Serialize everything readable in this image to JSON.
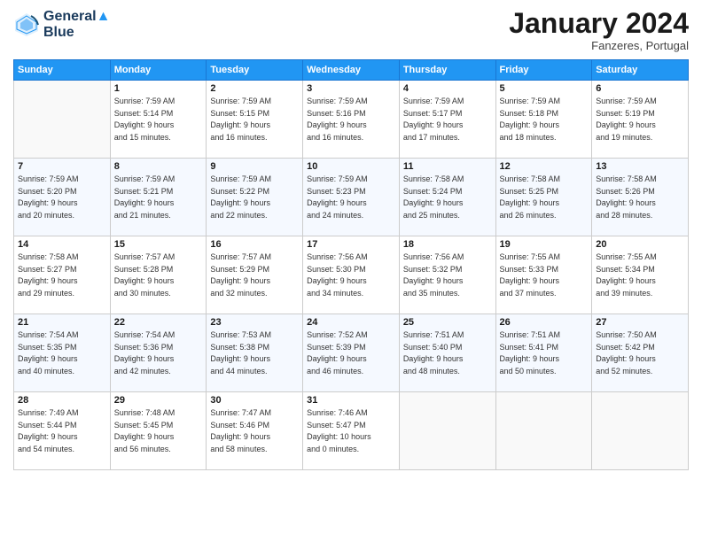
{
  "header": {
    "logo_line1": "General",
    "logo_line2": "Blue",
    "month": "January 2024",
    "location": "Fanzeres, Portugal"
  },
  "weekdays": [
    "Sunday",
    "Monday",
    "Tuesday",
    "Wednesday",
    "Thursday",
    "Friday",
    "Saturday"
  ],
  "weeks": [
    [
      {
        "day": "",
        "info": ""
      },
      {
        "day": "1",
        "info": "Sunrise: 7:59 AM\nSunset: 5:14 PM\nDaylight: 9 hours\nand 15 minutes."
      },
      {
        "day": "2",
        "info": "Sunrise: 7:59 AM\nSunset: 5:15 PM\nDaylight: 9 hours\nand 16 minutes."
      },
      {
        "day": "3",
        "info": "Sunrise: 7:59 AM\nSunset: 5:16 PM\nDaylight: 9 hours\nand 16 minutes."
      },
      {
        "day": "4",
        "info": "Sunrise: 7:59 AM\nSunset: 5:17 PM\nDaylight: 9 hours\nand 17 minutes."
      },
      {
        "day": "5",
        "info": "Sunrise: 7:59 AM\nSunset: 5:18 PM\nDaylight: 9 hours\nand 18 minutes."
      },
      {
        "day": "6",
        "info": "Sunrise: 7:59 AM\nSunset: 5:19 PM\nDaylight: 9 hours\nand 19 minutes."
      }
    ],
    [
      {
        "day": "7",
        "info": "Sunrise: 7:59 AM\nSunset: 5:20 PM\nDaylight: 9 hours\nand 20 minutes."
      },
      {
        "day": "8",
        "info": "Sunrise: 7:59 AM\nSunset: 5:21 PM\nDaylight: 9 hours\nand 21 minutes."
      },
      {
        "day": "9",
        "info": "Sunrise: 7:59 AM\nSunset: 5:22 PM\nDaylight: 9 hours\nand 22 minutes."
      },
      {
        "day": "10",
        "info": "Sunrise: 7:59 AM\nSunset: 5:23 PM\nDaylight: 9 hours\nand 24 minutes."
      },
      {
        "day": "11",
        "info": "Sunrise: 7:58 AM\nSunset: 5:24 PM\nDaylight: 9 hours\nand 25 minutes."
      },
      {
        "day": "12",
        "info": "Sunrise: 7:58 AM\nSunset: 5:25 PM\nDaylight: 9 hours\nand 26 minutes."
      },
      {
        "day": "13",
        "info": "Sunrise: 7:58 AM\nSunset: 5:26 PM\nDaylight: 9 hours\nand 28 minutes."
      }
    ],
    [
      {
        "day": "14",
        "info": "Sunrise: 7:58 AM\nSunset: 5:27 PM\nDaylight: 9 hours\nand 29 minutes."
      },
      {
        "day": "15",
        "info": "Sunrise: 7:57 AM\nSunset: 5:28 PM\nDaylight: 9 hours\nand 30 minutes."
      },
      {
        "day": "16",
        "info": "Sunrise: 7:57 AM\nSunset: 5:29 PM\nDaylight: 9 hours\nand 32 minutes."
      },
      {
        "day": "17",
        "info": "Sunrise: 7:56 AM\nSunset: 5:30 PM\nDaylight: 9 hours\nand 34 minutes."
      },
      {
        "day": "18",
        "info": "Sunrise: 7:56 AM\nSunset: 5:32 PM\nDaylight: 9 hours\nand 35 minutes."
      },
      {
        "day": "19",
        "info": "Sunrise: 7:55 AM\nSunset: 5:33 PM\nDaylight: 9 hours\nand 37 minutes."
      },
      {
        "day": "20",
        "info": "Sunrise: 7:55 AM\nSunset: 5:34 PM\nDaylight: 9 hours\nand 39 minutes."
      }
    ],
    [
      {
        "day": "21",
        "info": "Sunrise: 7:54 AM\nSunset: 5:35 PM\nDaylight: 9 hours\nand 40 minutes."
      },
      {
        "day": "22",
        "info": "Sunrise: 7:54 AM\nSunset: 5:36 PM\nDaylight: 9 hours\nand 42 minutes."
      },
      {
        "day": "23",
        "info": "Sunrise: 7:53 AM\nSunset: 5:38 PM\nDaylight: 9 hours\nand 44 minutes."
      },
      {
        "day": "24",
        "info": "Sunrise: 7:52 AM\nSunset: 5:39 PM\nDaylight: 9 hours\nand 46 minutes."
      },
      {
        "day": "25",
        "info": "Sunrise: 7:51 AM\nSunset: 5:40 PM\nDaylight: 9 hours\nand 48 minutes."
      },
      {
        "day": "26",
        "info": "Sunrise: 7:51 AM\nSunset: 5:41 PM\nDaylight: 9 hours\nand 50 minutes."
      },
      {
        "day": "27",
        "info": "Sunrise: 7:50 AM\nSunset: 5:42 PM\nDaylight: 9 hours\nand 52 minutes."
      }
    ],
    [
      {
        "day": "28",
        "info": "Sunrise: 7:49 AM\nSunset: 5:44 PM\nDaylight: 9 hours\nand 54 minutes."
      },
      {
        "day": "29",
        "info": "Sunrise: 7:48 AM\nSunset: 5:45 PM\nDaylight: 9 hours\nand 56 minutes."
      },
      {
        "day": "30",
        "info": "Sunrise: 7:47 AM\nSunset: 5:46 PM\nDaylight: 9 hours\nand 58 minutes."
      },
      {
        "day": "31",
        "info": "Sunrise: 7:46 AM\nSunset: 5:47 PM\nDaylight: 10 hours\nand 0 minutes."
      },
      {
        "day": "",
        "info": ""
      },
      {
        "day": "",
        "info": ""
      },
      {
        "day": "",
        "info": ""
      }
    ]
  ]
}
